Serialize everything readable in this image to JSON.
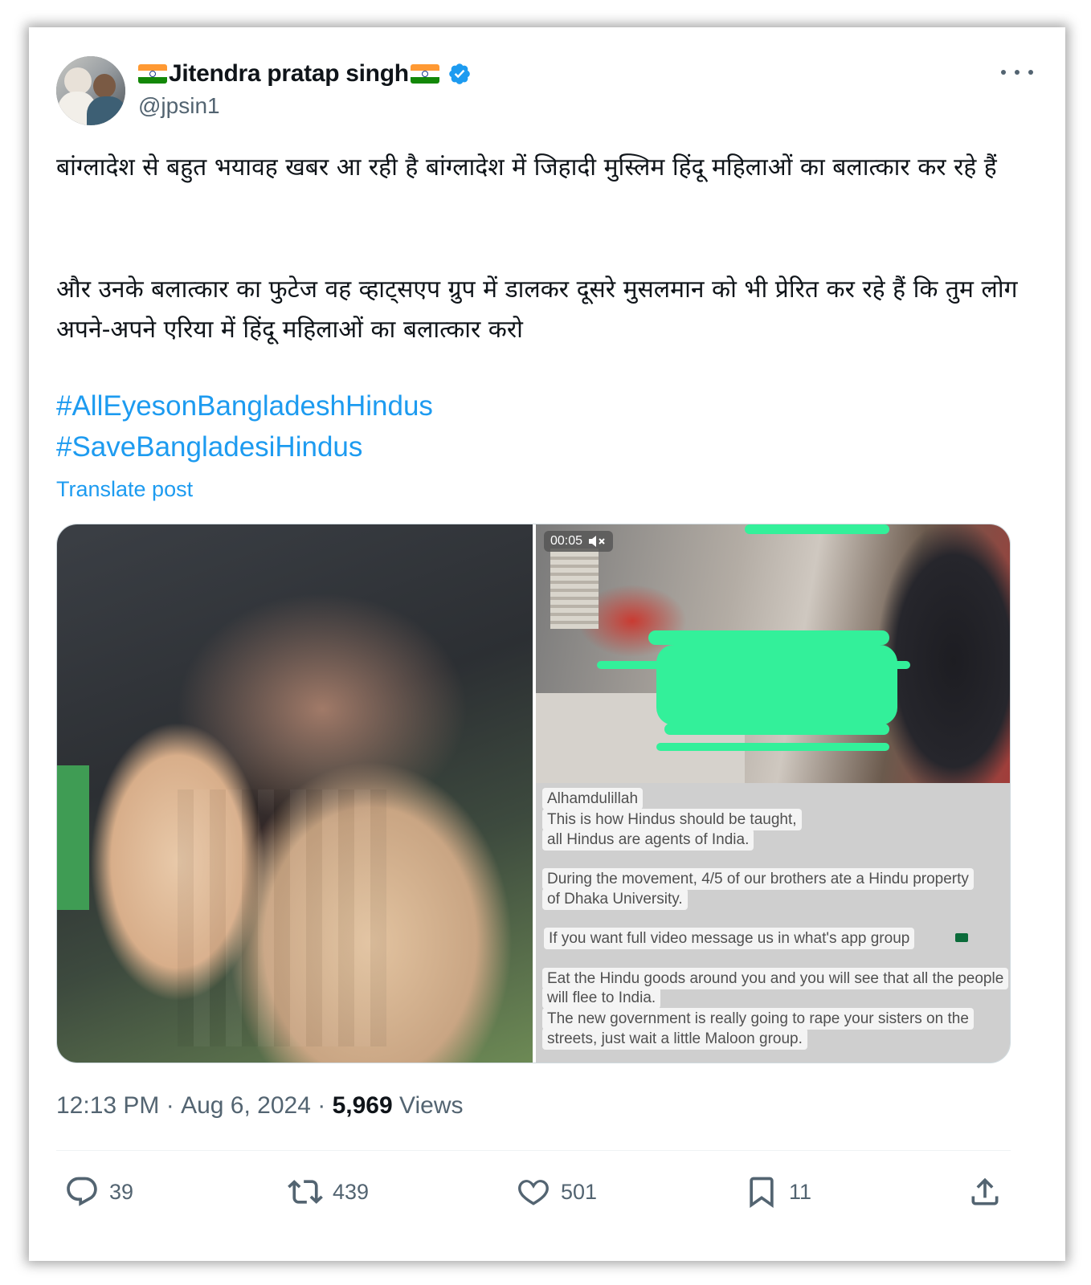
{
  "tweet": {
    "author": {
      "display_name": "Jitendra pratap singh",
      "handle": "@jpsin1",
      "verified": true
    },
    "paragraph_1": "बांग्लादेश से बहुत भयावह  खबर आ रही है बांग्लादेश में जिहादी मुस्लिम हिंदू महिलाओं का बलात्कार कर रहे हैं",
    "paragraph_2": " और उनके बलात्कार का फुटेज वह व्हाट्सएप ग्रुप में डालकर दूसरे मुसलमान को भी प्रेरित कर रहे हैं कि तुम लोग अपने-अपने एरिया में हिंदू महिलाओं का बलात्कार करो",
    "hashtags": [
      "#AllEyesonBangladeshHindus",
      "#SaveBangladesiHindus"
    ],
    "translate_label": "Translate post",
    "media": {
      "video_time": "00:05",
      "chat_lines": [
        "Alhamdulillah",
        "This is how Hindus should be taught,",
        "all Hindus are agents of India.",
        "During the movement, 4/5 of our brothers ate a Hindu property",
        "of Dhaka University.",
        "If you want full video message us in what's app group",
        "Eat the Hindu goods around you and you will see that all the people",
        "will flee to India.",
        "The new government is really going to rape your sisters on the",
        "streets, just wait a little Maloon group."
      ]
    },
    "time": "12:13 PM",
    "date": "Aug 6, 2024",
    "views_count": "5,969",
    "views_label": "Views",
    "actions": {
      "replies": "39",
      "reposts": "439",
      "likes": "501",
      "bookmarks": "11"
    }
  },
  "icons": {
    "reply": "reply-icon",
    "repost": "repost-icon",
    "like": "heart-icon",
    "bookmark": "bookmark-icon",
    "share": "share-icon",
    "more": "more-icon",
    "verified": "verified-badge-icon",
    "mute": "mute-icon"
  },
  "colors": {
    "accent": "#1d9bf0",
    "secondary_text": "#536471",
    "scribble": "#33f09a"
  }
}
